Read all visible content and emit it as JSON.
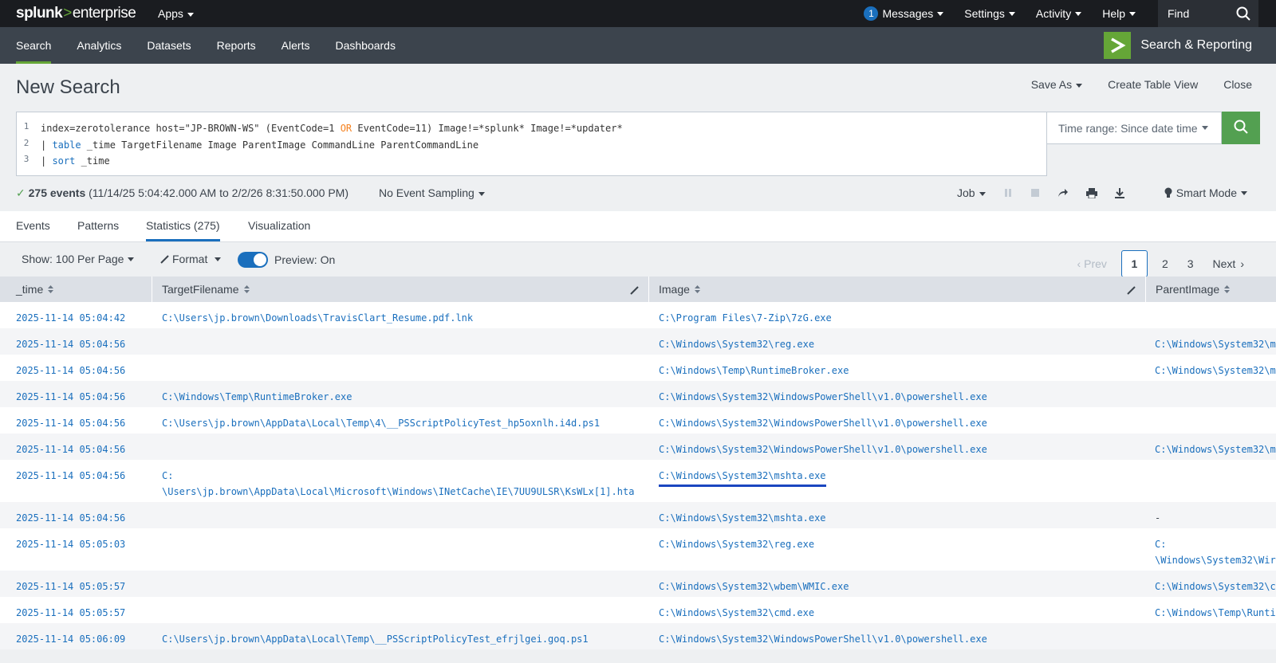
{
  "topbar": {
    "logo_splunk": "splunk",
    "logo_gt": ">",
    "logo_enterprise": "enterprise",
    "apps_label": "Apps",
    "messages_count": "1",
    "messages_label": "Messages",
    "settings_label": "Settings",
    "activity_label": "Activity",
    "help_label": "Help",
    "find_placeholder": "Find"
  },
  "appbar": {
    "tabs": [
      "Search",
      "Analytics",
      "Datasets",
      "Reports",
      "Alerts",
      "Dashboards"
    ],
    "active_tab": "Search",
    "app_name": "Search & Reporting"
  },
  "page": {
    "title": "New Search",
    "save_as": "Save As",
    "create_table_view": "Create Table View",
    "close": "Close"
  },
  "search": {
    "line_numbers": [
      "1",
      "2",
      "3"
    ],
    "line1_a": "index=zerotolerance host=\"JP-BROWN-WS\" (EventCode=1 ",
    "line1_or": "OR",
    "line1_b": " EventCode=11) Image!=*splunk* Image!=*updater*",
    "line2_pipe": "| ",
    "line2_cmd": "table",
    "line2_rest": " _time TargetFilename Image ParentImage CommandLine ParentCommandLine",
    "line3_pipe": "| ",
    "line3_cmd": "sort",
    "line3_rest": " _time",
    "time_range": "Time range: Since date time"
  },
  "status": {
    "events_count": "275 events",
    "range": "(11/14/25 5:04:42.000 AM to 2/2/26 8:31:50.000 PM)",
    "sampling": "No Event Sampling",
    "job": "Job",
    "mode": "Smart Mode"
  },
  "result_tabs": {
    "events": "Events",
    "patterns": "Patterns",
    "statistics": "Statistics (275)",
    "visualization": "Visualization"
  },
  "controls": {
    "show": "Show: 100 Per Page",
    "format": "Format",
    "preview": "Preview: On",
    "prev": "Prev",
    "pages": [
      "1",
      "2",
      "3"
    ],
    "current_page": "1",
    "next": "Next"
  },
  "colors": {
    "accent_green": "#65a637",
    "link_blue": "#1a6fbd",
    "topbar_bg": "#1a1c20",
    "appbar_bg": "#3c444d"
  },
  "table": {
    "columns": [
      "_time",
      "TargetFilename",
      "Image",
      "ParentImage"
    ],
    "rows": [
      {
        "time": "2025-11-14 05:04:42",
        "target": "C:\\Users\\jp.brown\\Downloads\\TravisClart_Resume.pdf.lnk",
        "image": "C:\\Program Files\\7-Zip\\7zG.exe",
        "parent": ""
      },
      {
        "time": "2025-11-14 05:04:56",
        "target": "",
        "image": "C:\\Windows\\System32\\reg.exe",
        "parent": "C:\\Windows\\System32\\m"
      },
      {
        "time": "2025-11-14 05:04:56",
        "target": "",
        "image": "C:\\Windows\\Temp\\RuntimeBroker.exe",
        "parent": "C:\\Windows\\System32\\m"
      },
      {
        "time": "2025-11-14 05:04:56",
        "target": "C:\\Windows\\Temp\\RuntimeBroker.exe",
        "image": "C:\\Windows\\System32\\WindowsPowerShell\\v1.0\\powershell.exe",
        "parent": ""
      },
      {
        "time": "2025-11-14 05:04:56",
        "target": "C:\\Users\\jp.brown\\AppData\\Local\\Temp\\4\\__PSScriptPolicyTest_hp5oxnlh.i4d.ps1",
        "image": "C:\\Windows\\System32\\WindowsPowerShell\\v1.0\\powershell.exe",
        "parent": ""
      },
      {
        "time": "2025-11-14 05:04:56",
        "target": "",
        "image": "C:\\Windows\\System32\\WindowsPowerShell\\v1.0\\powershell.exe",
        "parent": "C:\\Windows\\System32\\m"
      },
      {
        "time": "2025-11-14 05:04:56",
        "target": "C:\n\\Users\\jp.brown\\AppData\\Local\\Microsoft\\Windows\\INetCache\\IE\\7UU9ULSR\\KsWLx[1].hta",
        "image": "C:\\Windows\\System32\\mshta.exe",
        "parent": ""
      },
      {
        "time": "2025-11-14 05:04:56",
        "target": "",
        "image": "C:\\Windows\\System32\\mshta.exe",
        "parent": "-"
      },
      {
        "time": "2025-11-14 05:05:03",
        "target": "",
        "image": "C:\\Windows\\System32\\reg.exe",
        "parent": "C:\n\\Windows\\System32\\Wir"
      },
      {
        "time": "2025-11-14 05:05:57",
        "target": "",
        "image": "C:\\Windows\\System32\\wbem\\WMIC.exe",
        "parent": "C:\\Windows\\System32\\c"
      },
      {
        "time": "2025-11-14 05:05:57",
        "target": "",
        "image": "C:\\Windows\\System32\\cmd.exe",
        "parent": "C:\\Windows\\Temp\\Runti"
      },
      {
        "time": "2025-11-14 05:06:09",
        "target": "C:\\Users\\jp.brown\\AppData\\Local\\Temp\\__PSScriptPolicyTest_efrjlgei.goq.ps1",
        "image": "C:\\Windows\\System32\\WindowsPowerShell\\v1.0\\powershell.exe",
        "parent": ""
      }
    ]
  }
}
